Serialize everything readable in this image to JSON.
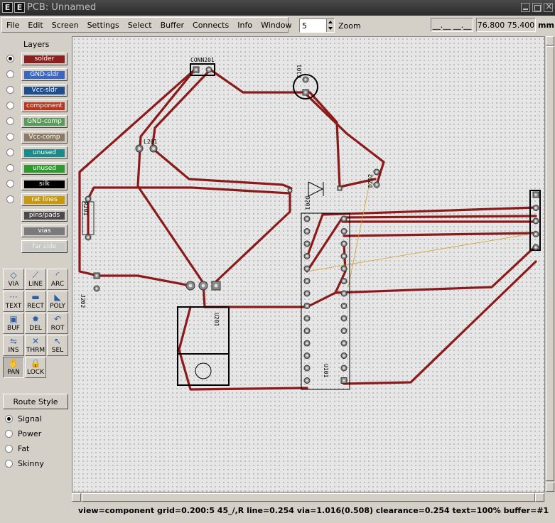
{
  "window": {
    "title": "PCB:  Unnamed",
    "icon_a": "E",
    "icon_b": "E"
  },
  "menu": [
    "File",
    "Edit",
    "Screen",
    "Settings",
    "Select",
    "Buffer",
    "Connects",
    "Info",
    "Window"
  ],
  "zoom": {
    "value": "5",
    "label": "Zoom"
  },
  "cursor_readout": "__.__  __.__",
  "coords": "76.800  75.400",
  "units": "mm",
  "layers_title": "Layers",
  "layers": [
    {
      "label": "solder",
      "color": "#8b2020",
      "selected": true
    },
    {
      "label": "GND-sldr",
      "color": "#3a67c4"
    },
    {
      "label": "Vcc-sldr",
      "color": "#1d4f8e"
    },
    {
      "label": "component",
      "color": "#b8341c"
    },
    {
      "label": "GND-comp",
      "color": "#5a9a5a"
    },
    {
      "label": "Vcc-comp",
      "color": "#8c7a66"
    },
    {
      "label": "unused",
      "color": "#1a8a8a"
    },
    {
      "label": "unused",
      "color": "#2e9a2e"
    },
    {
      "label": "silk",
      "color": "#000000"
    },
    {
      "label": "rat lines",
      "color": "#c89a10"
    },
    {
      "label": "pins/pads",
      "color": "#4a4a4a"
    },
    {
      "label": "vias",
      "color": "#7a7a7a"
    },
    {
      "label": "far side",
      "color": "#c8c8c8"
    }
  ],
  "tools": [
    {
      "label": "VIA",
      "icon": "via-icon",
      "glyph": "◇"
    },
    {
      "label": "LINE",
      "icon": "line-icon",
      "glyph": "⟋"
    },
    {
      "label": "ARC",
      "icon": "arc-icon",
      "glyph": "◜"
    },
    {
      "label": "TEXT",
      "icon": "text-icon",
      "glyph": "···"
    },
    {
      "label": "RECT",
      "icon": "rect-icon",
      "glyph": "▬"
    },
    {
      "label": "POLY",
      "icon": "poly-icon",
      "glyph": "◣"
    },
    {
      "label": "BUF",
      "icon": "buffer-icon",
      "glyph": "▣"
    },
    {
      "label": "DEL",
      "icon": "delete-icon",
      "glyph": "✹"
    },
    {
      "label": "ROT",
      "icon": "rotate-icon",
      "glyph": "↶"
    },
    {
      "label": "INS",
      "icon": "insert-icon",
      "glyph": "⇋"
    },
    {
      "label": "THRM",
      "icon": "thermal-icon",
      "glyph": "✕"
    },
    {
      "label": "SEL",
      "icon": "select-icon",
      "glyph": "↖"
    },
    {
      "label": "PAN",
      "icon": "pan-hand-icon",
      "glyph": "✋",
      "active": true
    },
    {
      "label": "LOCK",
      "icon": "lock-icon",
      "glyph": "🔒"
    }
  ],
  "route_style_button": "Route Style",
  "route_styles": [
    {
      "label": "Signal",
      "selected": true
    },
    {
      "label": "Power"
    },
    {
      "label": "Fat"
    },
    {
      "label": "Skinny"
    }
  ],
  "board_labels": {
    "conn": "CONN201",
    "c": "C101",
    "l": "L201",
    "d": "D201",
    "r": "R201",
    "d2": "D202",
    "u": "U201",
    "u2": "U101",
    "j": "J202"
  },
  "status": "view=component  grid=0.200:5  45_/,R    line=0.254  via=1.016(0.508)  clearance=0.254  text=100%  buffer=#1"
}
